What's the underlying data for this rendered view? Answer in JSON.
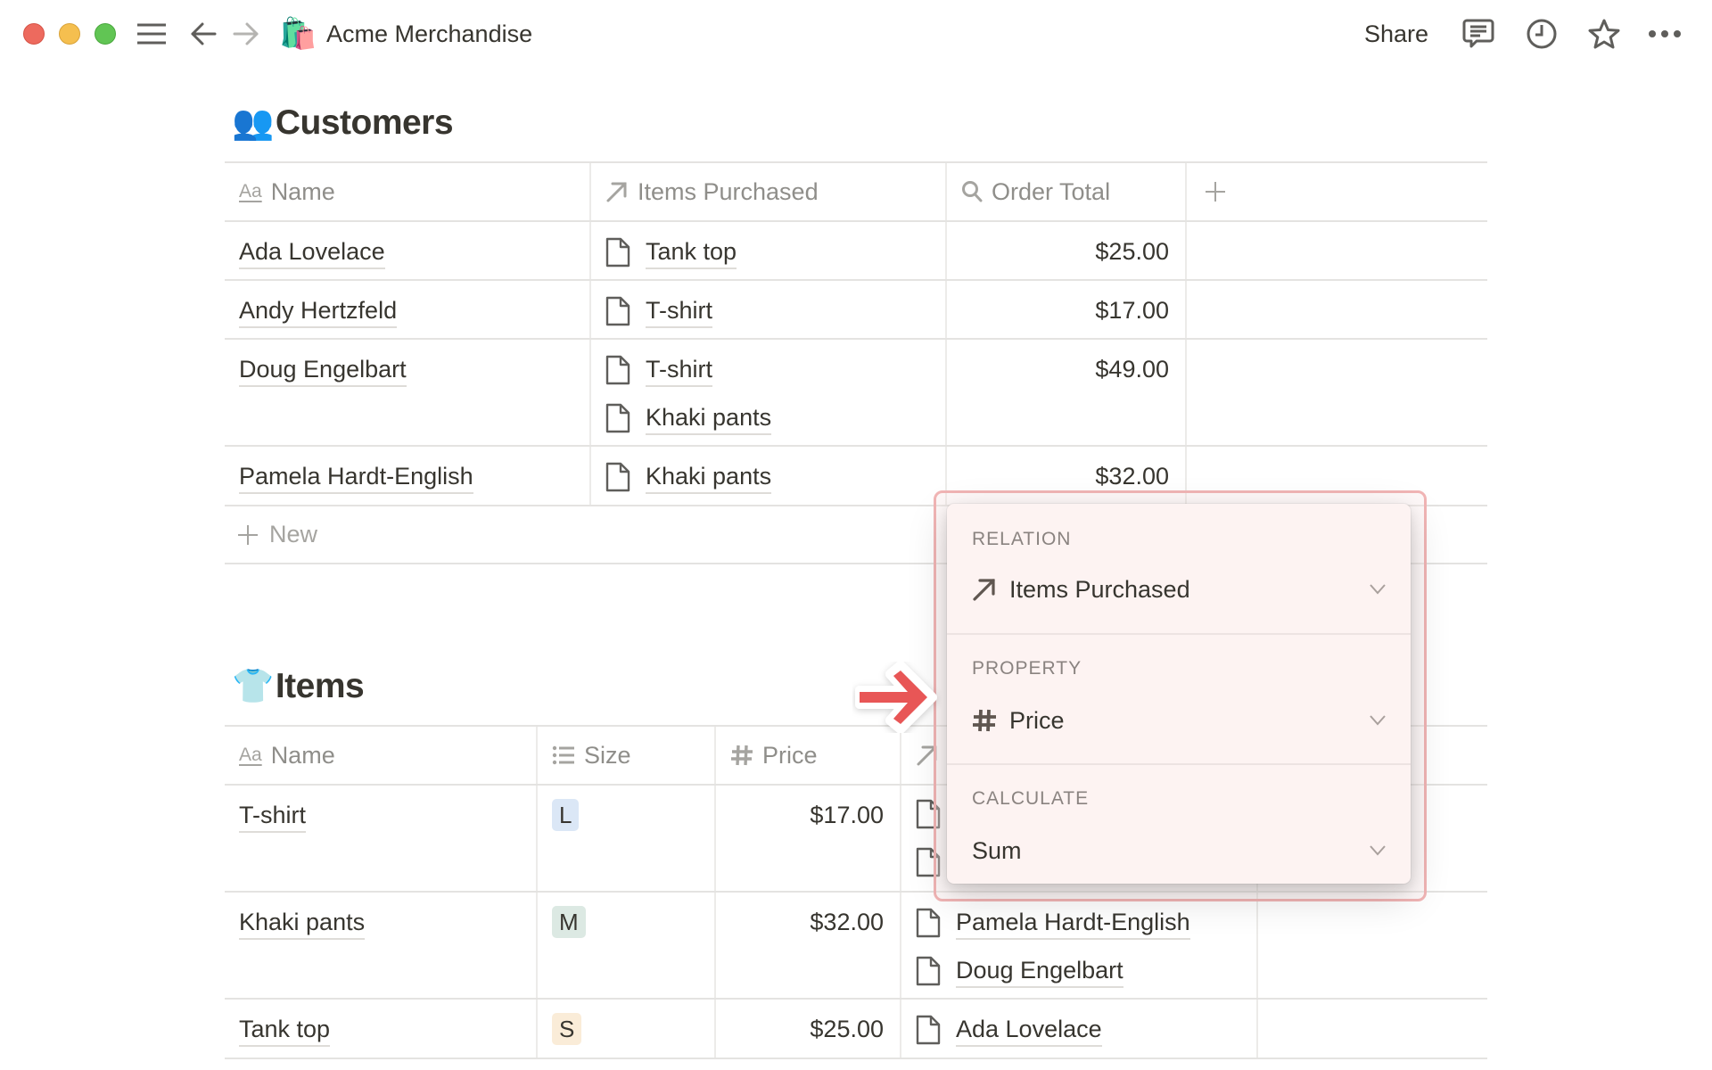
{
  "window": {
    "title": "Acme Merchandise",
    "page_icon": "🛍️",
    "share_label": "Share",
    "icons": [
      "hamburger-icon",
      "back-arrow-icon",
      "forward-arrow-icon",
      "comment-icon",
      "history-clock-icon",
      "star-icon",
      "more-dots-icon"
    ]
  },
  "customers": {
    "title": "Customers",
    "emoji": "👥",
    "columns": [
      {
        "label": "Name",
        "icon": "title-aa-icon"
      },
      {
        "label": "Items Purchased",
        "icon": "relation-arrow-icon"
      },
      {
        "label": "Order Total",
        "icon": "rollup-search-icon"
      },
      {
        "label": "+",
        "icon": "add-property-icon"
      }
    ],
    "rows": [
      {
        "name": "Ada Lovelace",
        "items": [
          "Tank top"
        ],
        "order_total": "$25.00"
      },
      {
        "name": "Andy Hertzfeld",
        "items": [
          "T-shirt"
        ],
        "order_total": "$17.00"
      },
      {
        "name": "Doug Engelbart",
        "items": [
          "T-shirt",
          "Khaki pants"
        ],
        "order_total": "$49.00"
      },
      {
        "name": "Pamela Hardt-English",
        "items": [
          "Khaki pants"
        ],
        "order_total": "$32.00"
      }
    ],
    "new_label": "New"
  },
  "items": {
    "title": "Items",
    "emoji": "👕",
    "columns": [
      {
        "label": "Name",
        "icon": "title-aa-icon"
      },
      {
        "label": "Size",
        "icon": "list-icon"
      },
      {
        "label": "Price",
        "icon": "number-hash-icon"
      },
      {
        "label": "",
        "icon": "relation-arrow-icon"
      }
    ],
    "rows": [
      {
        "name": "T-shirt",
        "size": "L",
        "size_color": "#dbe7f6",
        "price": "$17.00",
        "customers": [
          "",
          ""
        ]
      },
      {
        "name": "Khaki pants",
        "size": "M",
        "size_color": "#dce9e3",
        "price": "$32.00",
        "customers": [
          "Pamela Hardt-English",
          "Doug Engelbart"
        ]
      },
      {
        "name": "Tank top",
        "size": "S",
        "size_color": "#faecd8",
        "price": "$25.00",
        "customers": [
          "Ada Lovelace"
        ]
      }
    ]
  },
  "rollup_popup": {
    "relation_label": "RELATION",
    "relation_value": "Items Purchased",
    "property_label": "PROPERTY",
    "property_value": "Price",
    "calculate_label": "CALCULATE",
    "calculate_value": "Sum"
  },
  "colors": {
    "highlight_outline": "#f1b5b5",
    "popup_bg": "#fdf3f2",
    "annotation_arrow": "#e85656"
  }
}
